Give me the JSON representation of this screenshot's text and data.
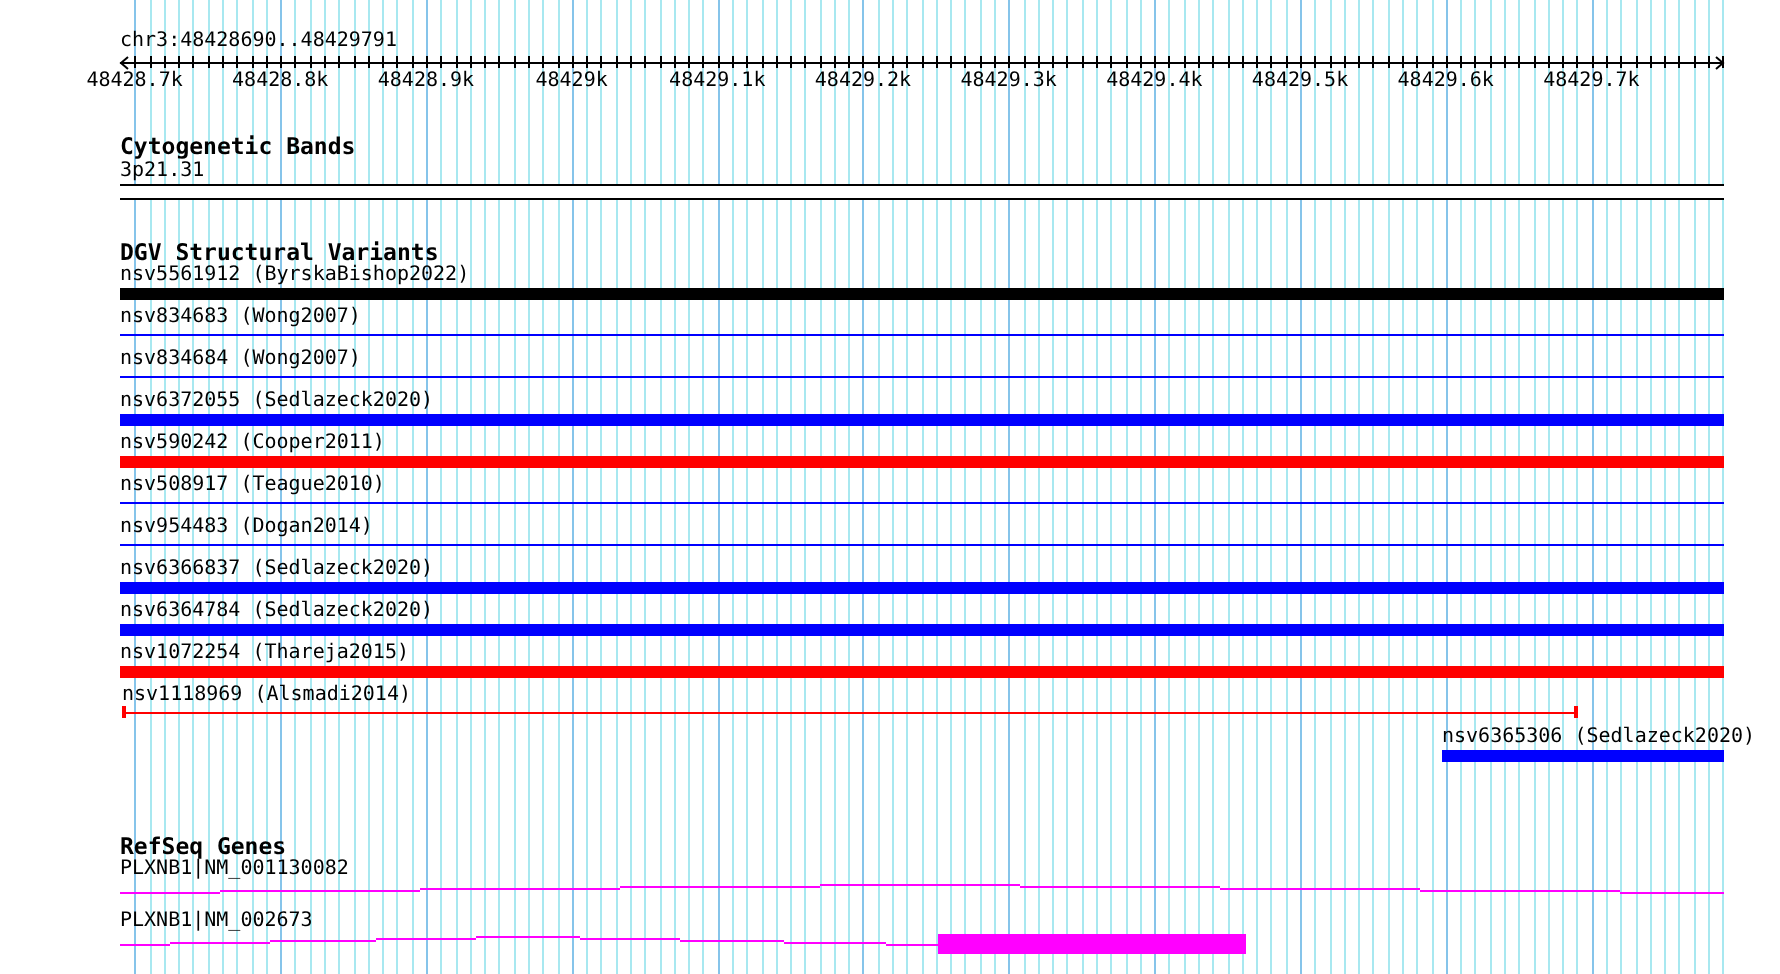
{
  "ruler": {
    "locus": "chr3:48428690..48429791",
    "tick_labels": [
      "48428.7k",
      "48428.8k",
      "48428.9k",
      "48429k",
      "48429.1k",
      "48429.2k",
      "48429.3k",
      "48429.4k",
      "48429.5k",
      "48429.6k",
      "48429.7k"
    ]
  },
  "tracks": [
    {
      "title": "Cytogenetic Bands",
      "kind": "cytoband",
      "features": [
        {
          "label": "3p21.31",
          "kind": "band"
        }
      ]
    },
    {
      "title": "DGV Structural Variants",
      "kind": "variants",
      "features": [
        {
          "label": "nsv5561912 (ByrskaBishop2022)",
          "kind": "thick",
          "color": "#000000"
        },
        {
          "label": "nsv834683 (Wong2007)",
          "kind": "thin",
          "color": "#0000ff"
        },
        {
          "label": "nsv834684 (Wong2007)",
          "kind": "thin",
          "color": "#0000ff"
        },
        {
          "label": "nsv6372055 (Sedlazeck2020)",
          "kind": "thick",
          "color": "#0000ff"
        },
        {
          "label": "nsv590242 (Cooper2011)",
          "kind": "thick",
          "color": "#ff0000"
        },
        {
          "label": "nsv508917 (Teague2010)",
          "kind": "thin",
          "color": "#0000ff"
        },
        {
          "label": "nsv954483 (Dogan2014)",
          "kind": "thin",
          "color": "#0000ff"
        },
        {
          "label": "nsv6366837 (Sedlazeck2020)",
          "kind": "thick",
          "color": "#0000ff"
        },
        {
          "label": "nsv6364784 (Sedlazeck2020)",
          "kind": "thick",
          "color": "#0000ff"
        },
        {
          "label": "nsv1072254 (Thareja2015)",
          "kind": "thick",
          "color": "#ff0000"
        },
        {
          "label": "nsv1118969 (Alsmadi2014)",
          "kind": "interval",
          "color": "#ff0000"
        },
        {
          "label": "nsv6365306 (Sedlazeck2020)",
          "kind": "thick",
          "color": "#0000ff"
        }
      ]
    },
    {
      "title": "RefSeq Genes",
      "kind": "genes",
      "features": [
        {
          "label": "PLXNB1|NM_001130082",
          "kind": "transcript",
          "color": "#ff00ff"
        },
        {
          "label": "PLXNB1|NM_002673",
          "kind": "transcript",
          "color": "#ff00ff"
        }
      ]
    }
  ]
}
